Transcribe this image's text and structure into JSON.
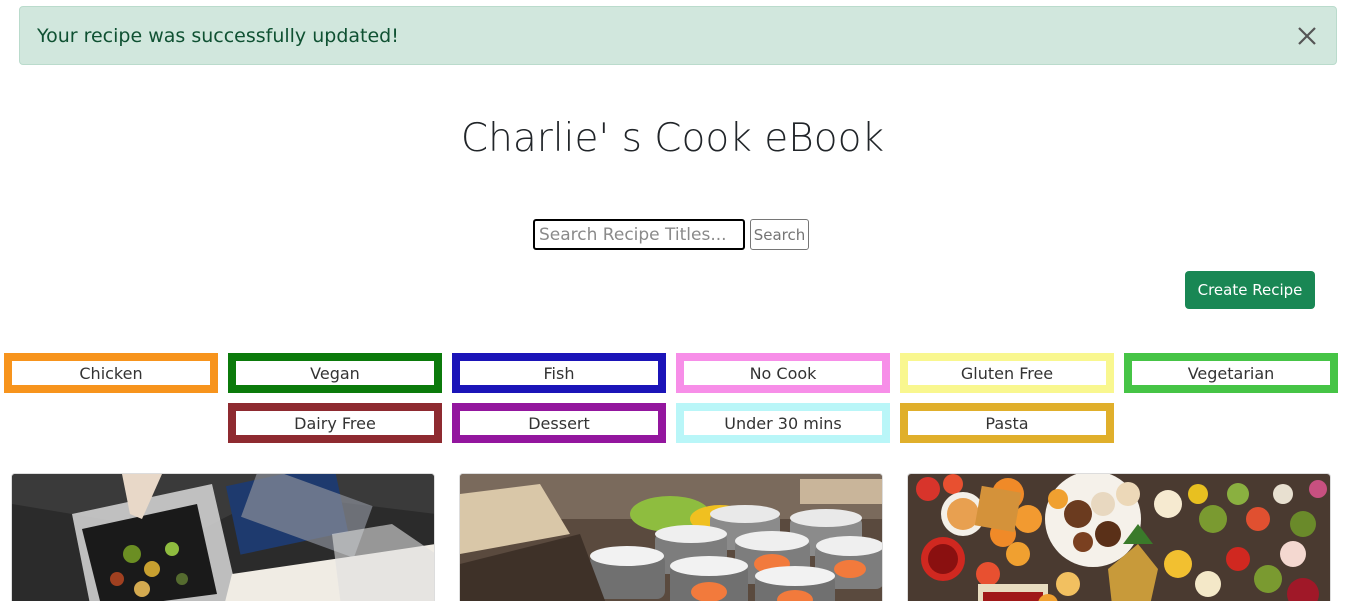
{
  "alert": {
    "message": "Your recipe was successfully updated!",
    "close_icon": "close-icon"
  },
  "header": {
    "title": "Charlie' s Cook eBook"
  },
  "search": {
    "placeholder": "Search Recipe Titles...",
    "value": "",
    "button_label": "Search"
  },
  "actions": {
    "create_label": "Create Recipe"
  },
  "categories": [
    {
      "label": "Chicken",
      "color": "#f7941d"
    },
    {
      "label": "Vegan",
      "color": "#0b7a0b"
    },
    {
      "label": "Fish",
      "color": "#1b14b8"
    },
    {
      "label": "No Cook",
      "color": "#f78ee8"
    },
    {
      "label": "Gluten Free",
      "color": "#f9f78f"
    },
    {
      "label": "Vegetarian",
      "color": "#46c446"
    },
    {
      "label": "Dairy Free",
      "color": "#8e2a30"
    },
    {
      "label": "Dessert",
      "color": "#93169e"
    },
    {
      "label": "Under 30 mins",
      "color": "#b9f6f8"
    },
    {
      "label": "Pasta",
      "color": "#e0af2b"
    }
  ],
  "cards": [
    {
      "image": "cooking-food-image"
    },
    {
      "image": "sushi-image"
    },
    {
      "image": "breakfast-spread-image"
    }
  ],
  "colors": {
    "success": "#198754",
    "alert_bg": "#d1e7dd",
    "alert_text": "#0f5132"
  }
}
